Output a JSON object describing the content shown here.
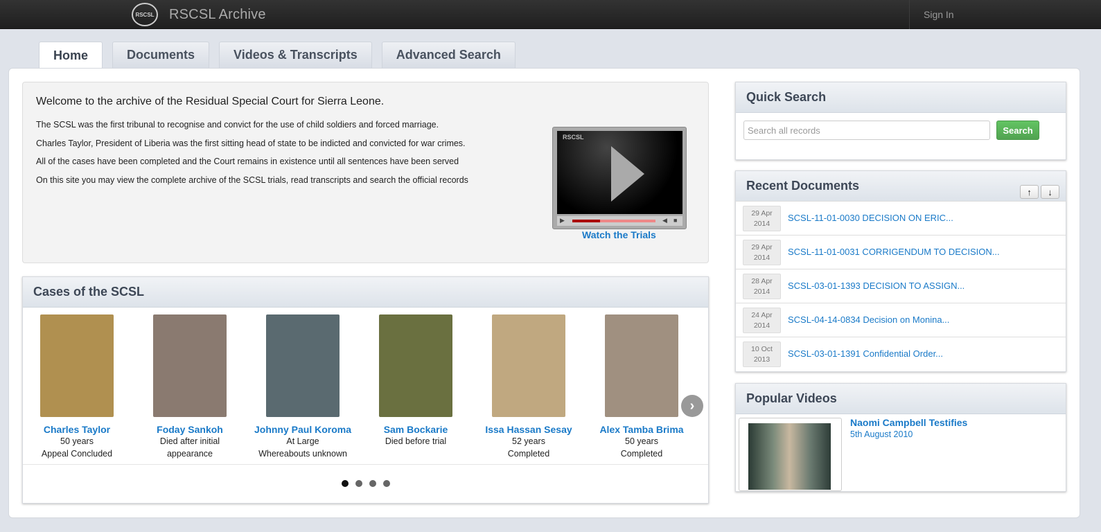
{
  "header": {
    "title": "RSCSL Archive",
    "logo_text": "RSCSL",
    "signin": "Sign In"
  },
  "tabs": [
    {
      "label": "Home",
      "active": true
    },
    {
      "label": "Documents",
      "active": false
    },
    {
      "label": "Videos & Transcripts",
      "active": false
    },
    {
      "label": "Advanced Search",
      "active": false
    }
  ],
  "welcome": {
    "heading": "Welcome to the archive of the Residual Special Court for Sierra Leone.",
    "paragraphs": [
      "The SCSL was the first tribunal to recognise and convict for the use of child soldiers and forced marriage.",
      "Charles Taylor, President of Liberia was the first sitting head of state to be indicted and convicted for war crimes.",
      "All of the cases have been completed and the Court remains in existence until all sentences have been served",
      "On this site you may view the complete archive of the SCSL trials, read transcripts and search the official records"
    ],
    "player_logo": "RSCSL",
    "watch_link": "Watch the Trials"
  },
  "cases": {
    "title": "Cases of the SCSL",
    "items": [
      {
        "name": "Charles Taylor",
        "line1": "50 years",
        "line2": "Appeal Concluded",
        "photo_color": "#b09050"
      },
      {
        "name": "Foday Sankoh",
        "line1": "Died after initial",
        "line2": "appearance",
        "photo_color": "#8a7a70"
      },
      {
        "name": "Johnny Paul Koroma",
        "line1": "At Large",
        "line2": "Whereabouts unknown",
        "photo_color": "#5a6a70"
      },
      {
        "name": "Sam Bockarie",
        "line1": "Died before trial",
        "line2": "",
        "photo_color": "#6a7040"
      },
      {
        "name": "Issa Hassan Sesay",
        "line1": "52 years",
        "line2": "Completed",
        "photo_color": "#c0a880"
      },
      {
        "name": "Alex Tamba Brima",
        "line1": "50 years",
        "line2": "Completed",
        "photo_color": "#a09080"
      }
    ],
    "pages": 4,
    "current_page": 1
  },
  "quick_search": {
    "title": "Quick Search",
    "placeholder": "Search all records",
    "button": "Search"
  },
  "recent_documents": {
    "title": "Recent Documents",
    "items": [
      {
        "day": "29 Apr",
        "year": "2014",
        "title": "SCSL-11-01-0030 DECISION ON ERIC..."
      },
      {
        "day": "29 Apr",
        "year": "2014",
        "title": "SCSL-11-01-0031 CORRIGENDUM TO DECISION..."
      },
      {
        "day": "28 Apr",
        "year": "2014",
        "title": "SCSL-03-01-1393 DECISION TO ASSIGN..."
      },
      {
        "day": "24 Apr",
        "year": "2014",
        "title": "SCSL-04-14-0834 Decision on Monina..."
      },
      {
        "day": "10 Oct",
        "year": "2013",
        "title": "SCSL-03-01-1391 Confidential Order..."
      }
    ]
  },
  "popular_videos": {
    "title": "Popular Videos",
    "items": [
      {
        "title": "Naomi Campbell Testifies",
        "date": "5th August 2010"
      }
    ]
  }
}
